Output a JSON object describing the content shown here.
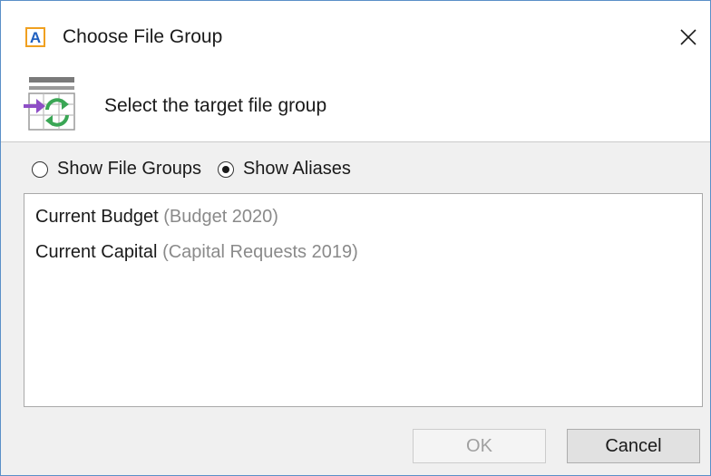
{
  "window": {
    "title": "Choose File Group",
    "app_icon_letter": "A",
    "app_icon": "app-logo-icon",
    "close_icon": "close-icon",
    "border_color": "#5a8fc8"
  },
  "header": {
    "icon": "file-group-sync-icon",
    "text": "Select the target file group"
  },
  "view_options": [
    {
      "label": "Show File Groups",
      "selected": false
    },
    {
      "label": "Show Aliases",
      "selected": true
    }
  ],
  "list": {
    "items": [
      {
        "alias": "Current Budget",
        "file_group": "(Budget 2020)"
      },
      {
        "alias": "Current Capital",
        "file_group": "(Capital Requests 2019)"
      }
    ]
  },
  "buttons": {
    "ok_label": "OK",
    "ok_enabled": false,
    "cancel_label": "Cancel"
  },
  "colors": {
    "secondary_text": "#8a8a8a",
    "icon_arrow": "#8e4ec6",
    "icon_sync": "#3aa655"
  }
}
